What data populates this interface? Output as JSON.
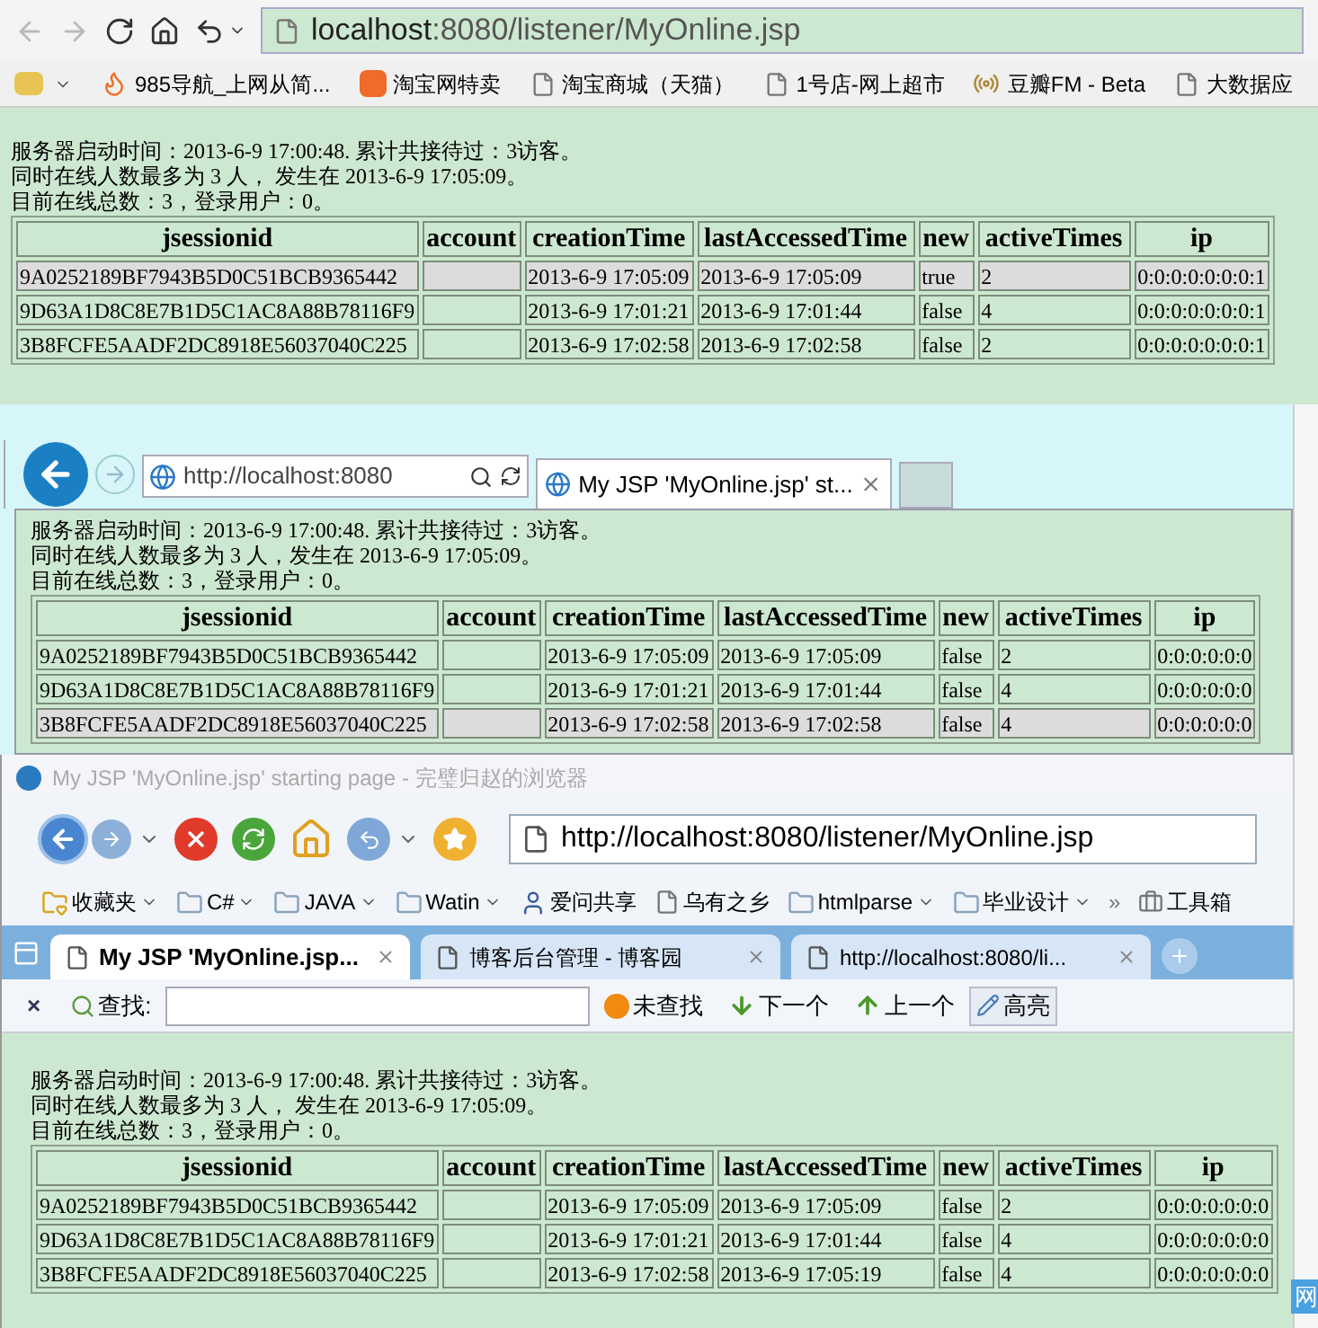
{
  "browser_1": {
    "url_host": "localhost",
    "url_rest": ":8080/listener/MyOnline.jsp",
    "bookmarks": [
      {
        "label": "985导航_上网从简...",
        "kind": "flame"
      },
      {
        "label": "淘宝网特卖",
        "kind": "taobao"
      },
      {
        "label": "淘宝商城（天猫）",
        "kind": "page"
      },
      {
        "label": "1号店-网上超市",
        "kind": "page"
      },
      {
        "label": "豆瓣FM - Beta",
        "kind": "radio"
      },
      {
        "label": "大数据应",
        "kind": "page"
      }
    ],
    "page": {
      "lines": [
        "服务器启动时间：2013-6-9 17:00:48. 累计共接待过：3访客。",
        "同时在线人数最多为  3 人，  发生在  2013-6-9 17:05:09。",
        "目前在线总数：3，登录用户：0。"
      ],
      "table": {
        "columns": [
          "jsessionid",
          "account",
          "creationTime",
          "lastAccessedTime",
          "new",
          "activeTimes",
          "ip"
        ],
        "rows": [
          {
            "highlighted": true,
            "cells": [
              "9A0252189BF7943B5D0C51BCB9365442",
              "",
              "2013-6-9 17:05:09",
              "2013-6-9 17:05:09",
              "true",
              "2",
              "0:0:0:0:0:0:0:1"
            ]
          },
          {
            "highlighted": false,
            "cells": [
              "9D63A1D8C8E7B1D5C1AC8A88B78116F9",
              "",
              "2013-6-9 17:01:21",
              "2013-6-9 17:01:44",
              "false",
              "4",
              "0:0:0:0:0:0:0:1"
            ]
          },
          {
            "highlighted": false,
            "cells": [
              "3B8FCFE5AADF2DC8918E56037040C225",
              "",
              "2013-6-9 17:02:58",
              "2013-6-9 17:02:58",
              "false",
              "2",
              "0:0:0:0:0:0:0:1"
            ]
          }
        ]
      }
    }
  },
  "browser_2": {
    "address": "http://localhost:8080",
    "tab": "My JSP 'MyOnline.jsp' st...",
    "page": {
      "lines": [
        "服务器启动时间：2013-6-9 17:00:48. 累计共接待过：3访客。",
        "同时在线人数最多为 3 人，发生在 2013-6-9 17:05:09。",
        "目前在线总数：3，登录用户：0。"
      ],
      "table": {
        "columns": [
          "jsessionid",
          "account",
          "creationTime",
          "lastAccessedTime",
          "new",
          "activeTimes",
          "ip"
        ],
        "rows": [
          {
            "highlighted": false,
            "cells": [
              "9A0252189BF7943B5D0C51BCB9365442",
              "",
              "2013-6-9 17:05:09",
              "2013-6-9 17:05:09",
              "false",
              "2",
              "0:0:0:0:0:0"
            ]
          },
          {
            "highlighted": false,
            "cells": [
              "9D63A1D8C8E7B1D5C1AC8A88B78116F9",
              "",
              "2013-6-9 17:01:21",
              "2013-6-9 17:01:44",
              "false",
              "4",
              "0:0:0:0:0:0"
            ]
          },
          {
            "highlighted": true,
            "cells": [
              "3B8FCFE5AADF2DC8918E56037040C225",
              "",
              "2013-6-9 17:02:58",
              "2013-6-9 17:02:58",
              "false",
              "4",
              "0:0:0:0:0:0"
            ]
          }
        ]
      }
    }
  },
  "browser_3": {
    "title": "My JSP 'MyOnline.jsp' starting page - 完璧归赵的浏览器",
    "address": "http://localhost:8080/listener/MyOnline.jsp",
    "bookmarks": [
      {
        "label": "收藏夹",
        "kind": "star-folder",
        "menu": true
      },
      {
        "label": "C#",
        "kind": "folder",
        "menu": true
      },
      {
        "label": "JAVA",
        "kind": "folder",
        "menu": true
      },
      {
        "label": "Watin",
        "kind": "folder",
        "menu": true
      },
      {
        "label": "爱问共享",
        "kind": "person",
        "menu": false
      },
      {
        "label": "乌有之乡",
        "kind": "page",
        "menu": false
      },
      {
        "label": "htmlparse",
        "kind": "folder",
        "menu": true
      },
      {
        "label": "毕业设计",
        "kind": "folder",
        "menu": true
      }
    ],
    "more": "»",
    "toolbox": "工具箱",
    "tabs": [
      {
        "label": "My JSP 'MyOnline.jsp...",
        "selected": true
      },
      {
        "label": "博客后台管理 - 博客园",
        "selected": false
      },
      {
        "label": "http://localhost:8080/li...",
        "selected": false
      }
    ],
    "find": {
      "close": "×",
      "label": "查找:",
      "status": "未查找",
      "next": "下一个",
      "prev": "上一个",
      "highlight": "高亮"
    },
    "page": {
      "lines": [
        "服务器启动时间：2013-6-9 17:00:48. 累计共接待过：3访客。",
        "同时在线人数最多为  3 人，  发生在  2013-6-9 17:05:09。",
        "目前在线总数：3，登录用户：0。"
      ],
      "table": {
        "columns": [
          "jsessionid",
          "account",
          "creationTime",
          "lastAccessedTime",
          "new",
          "activeTimes",
          "ip"
        ],
        "rows": [
          {
            "highlighted": false,
            "cells": [
              "9A0252189BF7943B5D0C51BCB9365442",
              "",
              "2013-6-9 17:05:09",
              "2013-6-9 17:05:09",
              "false",
              "2",
              "0:0:0:0:0:0:0"
            ]
          },
          {
            "highlighted": false,
            "cells": [
              "9D63A1D8C8E7B1D5C1AC8A88B78116F9",
              "",
              "2013-6-9 17:01:21",
              "2013-6-9 17:01:44",
              "false",
              "4",
              "0:0:0:0:0:0:0"
            ]
          },
          {
            "highlighted": false,
            "cells": [
              "3B8FCFE5AADF2DC8918E56037040C225",
              "",
              "2013-6-9 17:02:58",
              "2013-6-9 17:05:19",
              "false",
              "4",
              "0:0:0:0:0:0:0"
            ]
          }
        ]
      }
    }
  },
  "side_window": {
    "label": "网"
  }
}
